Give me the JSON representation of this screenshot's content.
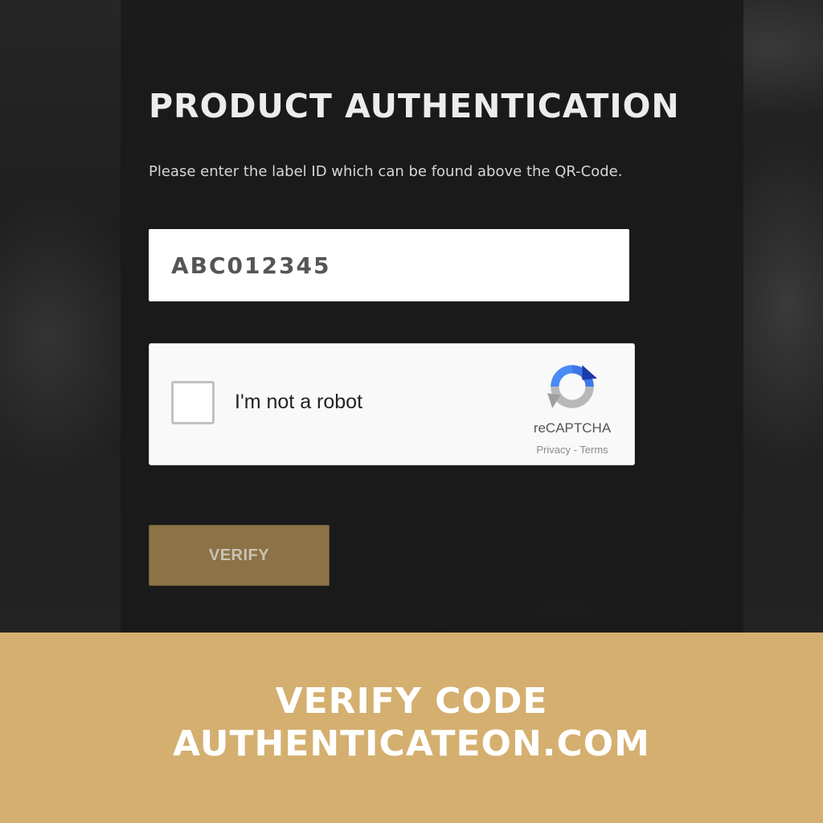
{
  "auth_page": {
    "title": "PRODUCT AUTHENTICATION",
    "instruction": "Please enter the label ID which can be found above the QR-Code.",
    "label_input": {
      "value": "ABC012345"
    },
    "captcha": {
      "label": "I'm not a robot",
      "brand": "reCAPTCHA",
      "privacy_link": "Privacy",
      "separator": " - ",
      "terms_link": "Terms",
      "checked": false
    },
    "verify_button": "VERIFY"
  },
  "banner": {
    "line1": "VERIFY CODE",
    "line2": "AUTHENTICATEON.COM"
  },
  "colors": {
    "banner_bg": "#d4af6f",
    "button_bg": "#8c7246",
    "panel_bg": "#1a1a1a",
    "recaptcha_blue": "#3b78e7",
    "recaptcha_dark_blue": "#1c3aa9",
    "recaptcha_gray": "#b8b8b8"
  },
  "icons": {
    "captcha_logo": "recaptcha-logo-icon"
  }
}
